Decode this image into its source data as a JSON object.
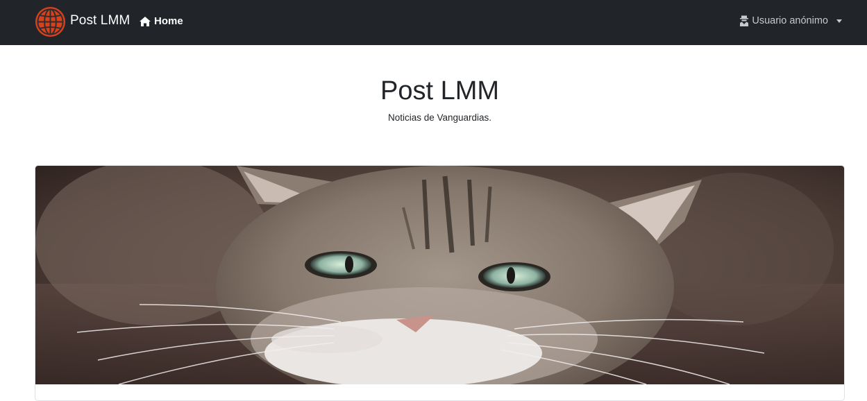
{
  "navbar": {
    "brand_name": "Post LMM",
    "home_label": "Home",
    "user_label": "Usuario anónimo",
    "logo_icon": "globe-icon",
    "home_icon": "home-icon",
    "user_icon": "user-secret-icon",
    "background": "#212529",
    "logo_color": "#d9401c"
  },
  "header": {
    "title": "Post LMM",
    "subtitle": "Noticias de Vanguardias."
  },
  "card": {
    "image_subject": "tabby-cat-photo"
  }
}
